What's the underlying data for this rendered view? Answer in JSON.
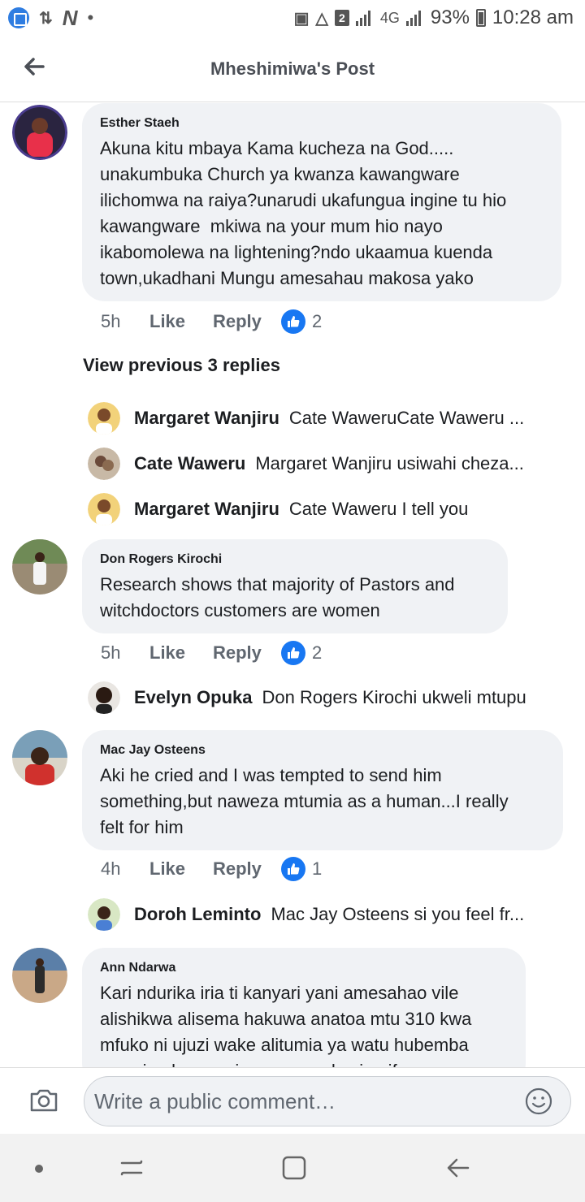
{
  "status_bar": {
    "signal_label": "4G",
    "sim_badge": "2",
    "battery": "93%",
    "time": "10:28 am"
  },
  "header": {
    "title": "Mheshimiwa's Post"
  },
  "comments": [
    {
      "author": "Esther Staeh",
      "text": "Akuna kitu mbaya Kama kucheza na God.....\nunakumbuka Church ya kwanza kawangware\nilichomwa na raiya?unarudi ukafungua ingine tu hio\nkawangware  mkiwa na your mum hio nayo\nikabomolewa na lightening?ndo ukaamua kuenda\ntown,ukadhani Mungu amesahau makosa yako",
      "time": "5h",
      "like_label": "Like",
      "reply_label": "Reply",
      "reactions": "2"
    },
    {
      "author": "Don Rogers Kirochi",
      "text": "Research shows that majority of Pastors and\nwitchdoctors customers are women",
      "time": "5h",
      "like_label": "Like",
      "reply_label": "Reply",
      "reactions": "2"
    },
    {
      "author": "Mac Jay Osteens",
      "text": "Aki he cried and I was tempted to send him\nsomething,but naweza mtumia as a human...I really\nfelt for him",
      "time": "4h",
      "like_label": "Like",
      "reply_label": "Reply",
      "reactions": "1"
    },
    {
      "author": "Ann Ndarwa",
      "text": "Kari ndurika iria ti kanyari yani amesahao vile\nalishikwa alisema hakuwa anatoa mtu 310 kwa\nmfuko ni ujuzi wake alitumia ya watu hubemba\nwengine kaa gunia ya avacado zimeifa"
    }
  ],
  "view_previous": "View previous 3 replies",
  "replies": [
    {
      "name": "Margaret Wanjiru",
      "text": "Cate WaweruCate Waweru ..."
    },
    {
      "name": "Cate Waweru",
      "text": "Margaret Wanjiru usiwahi cheza..."
    },
    {
      "name": "Margaret Wanjiru",
      "text": "Cate Waweru I tell you"
    },
    {
      "name": "Evelyn Opuka",
      "text": "Don Rogers Kirochi ukweli mtupu"
    },
    {
      "name": "Doroh Leminto",
      "text": "Mac Jay Osteens si you feel fr..."
    }
  ],
  "composer": {
    "placeholder": "Write a public comment…"
  },
  "colors": {
    "accent": "#1877f2",
    "bubble": "#f0f2f5",
    "muted": "#606770"
  }
}
